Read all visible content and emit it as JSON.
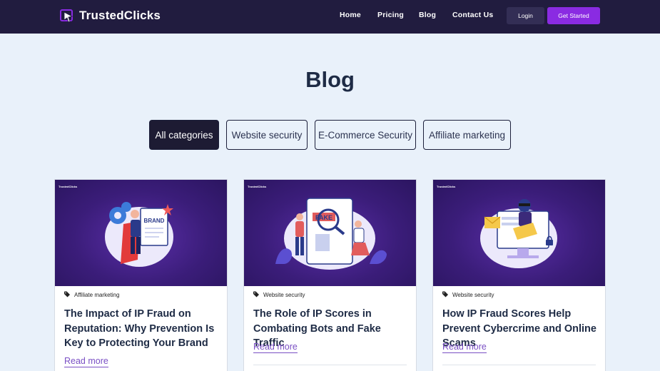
{
  "header": {
    "brand": "TrustedClicks",
    "nav": [
      "Home",
      "Pricing",
      "Blog",
      "Contact Us"
    ],
    "login_label": "Login",
    "get_started_label": "Get Started"
  },
  "page": {
    "title": "Blog"
  },
  "categories": [
    "All categories",
    "Website security",
    "E-Commerce Security",
    "Affiliate marketing"
  ],
  "active_category": "All categories",
  "posts": [
    {
      "image_brand": "TrustedClicks",
      "category": "Affiliate marketing",
      "title": "The Impact of IP Fraud on Reputation: Why Prevention Is Key to Protecting Your Brand",
      "read_more": "Read more",
      "image_text": "BRAND"
    },
    {
      "image_brand": "TrustedClicks",
      "category": "Website security",
      "title": "The Role of IP Scores in Combating Bots and Fake Traffic",
      "read_more": "Read more",
      "image_text": "FAKE"
    },
    {
      "image_brand": "TrustedClicks",
      "category": "Website security",
      "title": "How IP Fraud Scores Help Prevent Cybercrime and Online Scams",
      "read_more": "Read more"
    }
  ],
  "colors": {
    "header_bg": "#211c3f",
    "accent": "#8a2be2",
    "page_bg": "#e9f1fa",
    "active_pill": "#1d1b33",
    "link": "#7a4fc4"
  },
  "icons": [
    "cursor-logo-icon",
    "tag-icon"
  ]
}
